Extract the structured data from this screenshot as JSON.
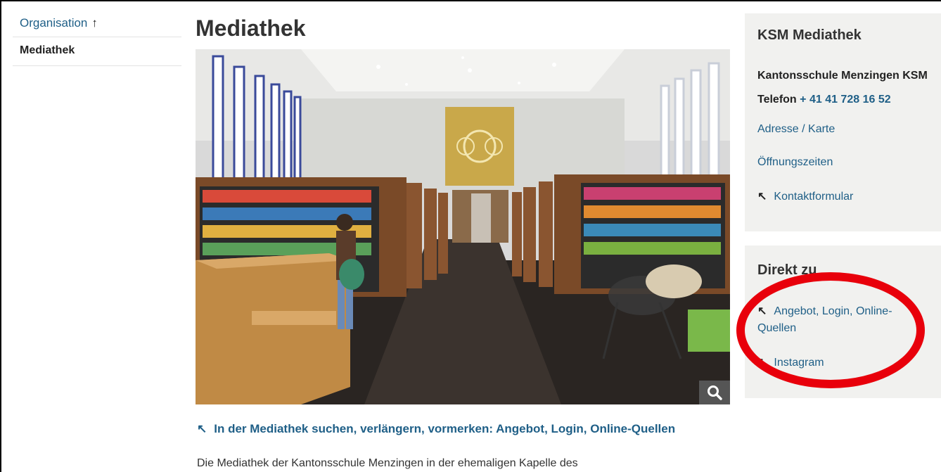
{
  "nav": {
    "parent_label": "Organisation",
    "parent_arrow": "↑",
    "current_label": "Mediathek"
  },
  "main": {
    "title": "Mediathek",
    "zoom_icon": "search-icon",
    "link_arrow": "↖",
    "link_text": "In der Mediathek suchen, verlängern, vormerken: Angebot, Login, Online-Quellen",
    "intro_text": "Die Mediathek der Kantonsschule Menzingen in der ehemaligen Kapelle des"
  },
  "contact": {
    "title": "KSM Mediathek",
    "org": "Kantonsschule Menzingen KSM",
    "phone_label": "Telefon",
    "phone": "+ 41 41 728 16 52",
    "address": "Adresse / Karte",
    "hours": "Öffnungszeiten",
    "form_arrow": "↖",
    "form": "Kontaktformular"
  },
  "direct": {
    "title": "Direkt zu",
    "link1_arrow": "↖",
    "link1_line1": "Angebot, Login, Online-",
    "link1_line2": "Quellen",
    "link2_arrow": "↖",
    "link2": "Instagram"
  },
  "annotation": {
    "color": "#e8000b"
  }
}
